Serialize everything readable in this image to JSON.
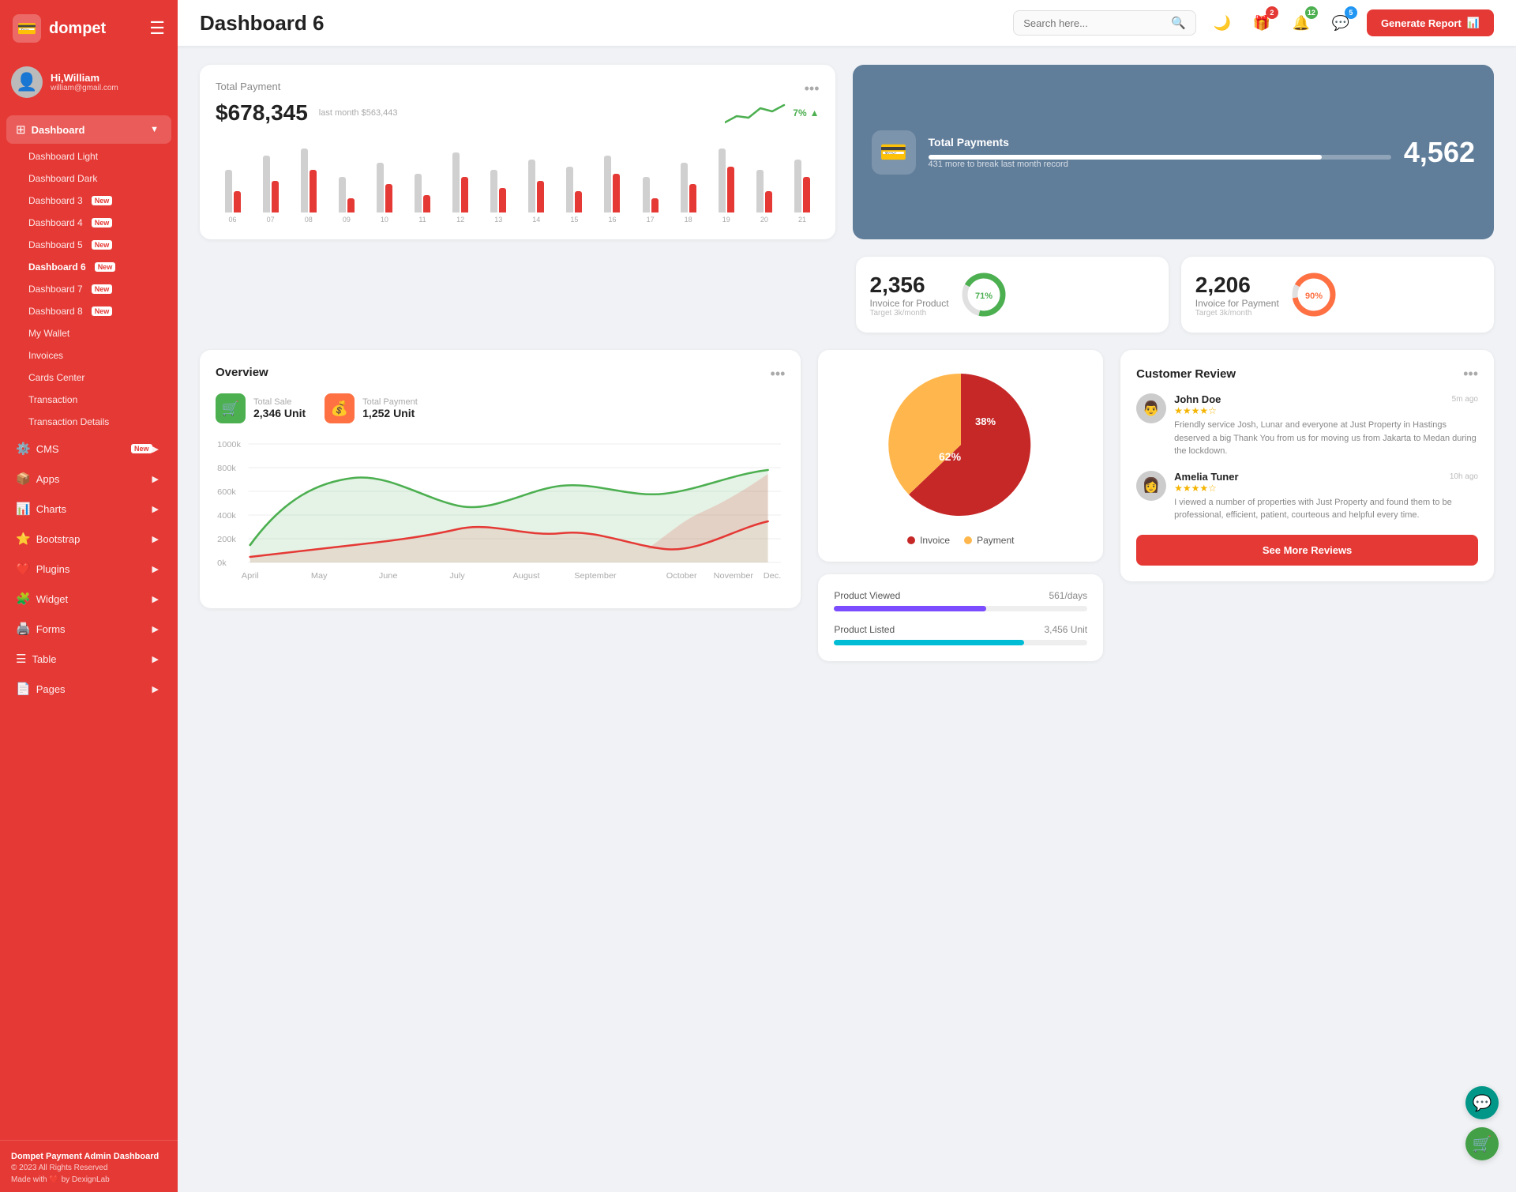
{
  "app": {
    "name": "dompet",
    "logo_icon": "💳"
  },
  "user": {
    "greeting": "Hi,William",
    "email": "william@gmail.com",
    "avatar_emoji": "👤"
  },
  "topbar": {
    "page_title": "Dashboard 6",
    "search_placeholder": "Search here...",
    "generate_report_label": "Generate Report"
  },
  "topbar_icons": {
    "moon_icon": "🌙",
    "gift_icon": "🎁",
    "gift_badge": "2",
    "bell_icon": "🔔",
    "bell_badge": "12",
    "chat_icon": "💬",
    "chat_badge": "5"
  },
  "sidebar": {
    "dashboard_label": "Dashboard",
    "items": [
      {
        "label": "Dashboard Light",
        "badge": null,
        "active": false
      },
      {
        "label": "Dashboard Dark",
        "badge": null,
        "active": false
      },
      {
        "label": "Dashboard 3",
        "badge": "New",
        "active": false
      },
      {
        "label": "Dashboard 4",
        "badge": "New",
        "active": false
      },
      {
        "label": "Dashboard 5",
        "badge": "New",
        "active": false
      },
      {
        "label": "Dashboard 6",
        "badge": "New",
        "active": true
      },
      {
        "label": "Dashboard 7",
        "badge": "New",
        "active": false
      },
      {
        "label": "Dashboard 8",
        "badge": "New",
        "active": false
      },
      {
        "label": "My Wallet",
        "badge": null,
        "active": false
      },
      {
        "label": "Invoices",
        "badge": null,
        "active": false
      },
      {
        "label": "Cards Center",
        "badge": null,
        "active": false
      },
      {
        "label": "Transaction",
        "badge": null,
        "active": false
      },
      {
        "label": "Transaction Details",
        "badge": null,
        "active": false
      }
    ],
    "nav_items": [
      {
        "label": "CMS",
        "badge": "New",
        "icon": "⚙️"
      },
      {
        "label": "Apps",
        "icon": "📦"
      },
      {
        "label": "Charts",
        "icon": "📊"
      },
      {
        "label": "Bootstrap",
        "icon": "⭐"
      },
      {
        "label": "Plugins",
        "icon": "❤️"
      },
      {
        "label": "Widget",
        "icon": "🧩"
      },
      {
        "label": "Forms",
        "icon": "🖨️"
      },
      {
        "label": "Table",
        "icon": "☰"
      },
      {
        "label": "Pages",
        "icon": "📄"
      }
    ],
    "footer": {
      "title": "Dompet Payment Admin Dashboard",
      "copyright": "© 2023 All Rights Reserved",
      "made_with": "Made with ❤️ by DexignLab"
    }
  },
  "total_payment": {
    "title": "Total Payment",
    "amount": "$678,345",
    "last_month_label": "last month $563,443",
    "trend_percent": "7%",
    "bars": [
      {
        "label": "06",
        "gray": 60,
        "red": 30
      },
      {
        "label": "07",
        "gray": 80,
        "red": 45
      },
      {
        "label": "08",
        "gray": 90,
        "red": 60
      },
      {
        "label": "09",
        "gray": 50,
        "red": 20
      },
      {
        "label": "10",
        "gray": 70,
        "red": 40
      },
      {
        "label": "11",
        "gray": 55,
        "red": 25
      },
      {
        "label": "12",
        "gray": 85,
        "red": 50
      },
      {
        "label": "13",
        "gray": 60,
        "red": 35
      },
      {
        "label": "14",
        "gray": 75,
        "red": 45
      },
      {
        "label": "15",
        "gray": 65,
        "red": 30
      },
      {
        "label": "16",
        "gray": 80,
        "red": 55
      },
      {
        "label": "17",
        "gray": 50,
        "red": 20
      },
      {
        "label": "18",
        "gray": 70,
        "red": 40
      },
      {
        "label": "19",
        "gray": 90,
        "red": 65
      },
      {
        "label": "20",
        "gray": 60,
        "red": 30
      },
      {
        "label": "21",
        "gray": 75,
        "red": 50
      }
    ]
  },
  "total_payments_blue": {
    "title": "Total Payments",
    "sub": "431 more to break last month record",
    "number": "4,562",
    "progress": 85
  },
  "invoice_product": {
    "number": "2,356",
    "label": "Invoice for Product",
    "target": "Target 3k/month",
    "percent": 71,
    "color": "#4caf50"
  },
  "invoice_payment": {
    "number": "2,206",
    "label": "Invoice for Payment",
    "target": "Target 3k/month",
    "percent": 90,
    "color": "#ff7043"
  },
  "overview": {
    "title": "Overview",
    "total_sale_label": "Total Sale",
    "total_sale_value": "2,346 Unit",
    "total_payment_label": "Total Payment",
    "total_payment_value": "1,252 Unit",
    "chart_labels": [
      "April",
      "May",
      "June",
      "July",
      "August",
      "September",
      "October",
      "November",
      "Dec."
    ],
    "y_labels": [
      "1000k",
      "800k",
      "600k",
      "400k",
      "200k",
      "0k"
    ]
  },
  "pie_chart": {
    "invoice_percent": 62,
    "payment_percent": 38,
    "invoice_label": "Invoice",
    "payment_label": "Payment"
  },
  "product_stats": [
    {
      "label": "Product Viewed",
      "value": "561/days",
      "fill_class": "fill-purple",
      "fill_width": "60%"
    },
    {
      "label": "Product Listed",
      "value": "3,456 Unit",
      "fill_class": "fill-cyan",
      "fill_width": "75%"
    }
  ],
  "customer_review": {
    "title": "Customer Review",
    "btn_label": "See More Reviews",
    "reviews": [
      {
        "name": "John Doe",
        "stars": 4,
        "time": "5m ago",
        "avatar_emoji": "👨",
        "text": "Friendly service Josh, Lunar and everyone at Just Property in Hastings deserved a big Thank You from us for moving us from Jakarta to Medan during the lockdown."
      },
      {
        "name": "Amelia Tuner",
        "stars": 4,
        "time": "10h ago",
        "avatar_emoji": "👩",
        "text": "I viewed a number of properties with Just Property and found them to be professional, efficient, patient, courteous and helpful every time."
      }
    ]
  },
  "floating": {
    "chat_icon": "💬",
    "cart_icon": "🛒"
  }
}
